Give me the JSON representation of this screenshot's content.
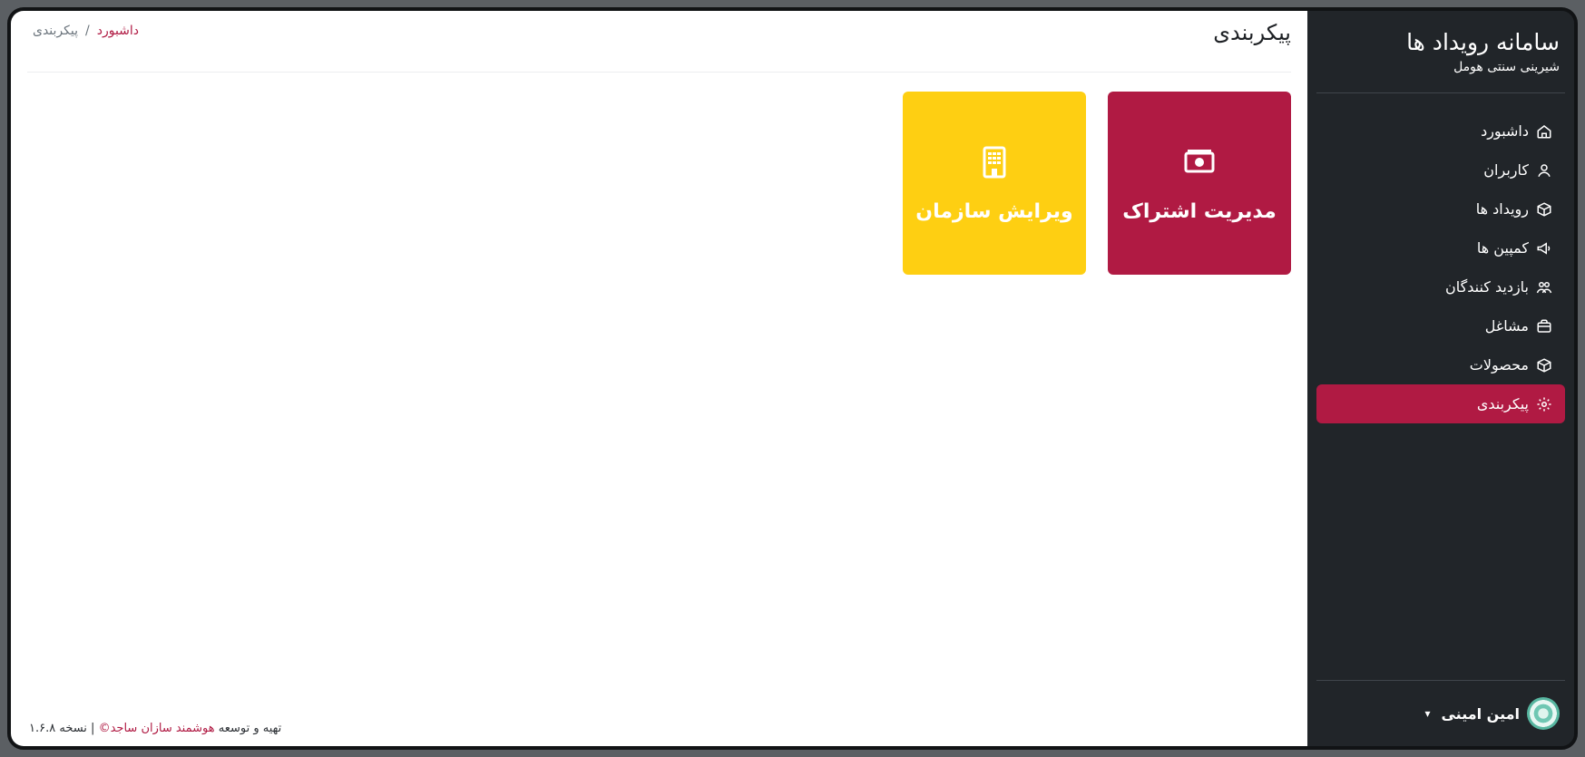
{
  "app": {
    "title": "سامانه رویداد ها",
    "org": "شیرینی سنتی هومل"
  },
  "sidebar": {
    "items": [
      {
        "label": "داشبورد",
        "icon": "home-icon"
      },
      {
        "label": "کاربران",
        "icon": "user-icon"
      },
      {
        "label": "رویداد ها",
        "icon": "box-icon"
      },
      {
        "label": "کمپین ها",
        "icon": "megaphone-icon"
      },
      {
        "label": "بازدید کنندگان",
        "icon": "users-icon"
      },
      {
        "label": "مشاغل",
        "icon": "briefcase-icon"
      },
      {
        "label": "محصولات",
        "icon": "package-icon"
      },
      {
        "label": "پیکربندی",
        "icon": "gear-icon",
        "active": true
      }
    ],
    "user": {
      "name": "امین امینی",
      "menu_caret": "▾"
    }
  },
  "header": {
    "title": "پیکربندی",
    "breadcrumb": {
      "home": "داشبورد",
      "separator": "/",
      "current": "پیکربندی"
    }
  },
  "cards": [
    {
      "label": "مدیریت اشتراک",
      "icon": "money-icon",
      "color": "#b01a43"
    },
    {
      "label": "ویرایش سازمان",
      "icon": "building-icon",
      "color": "#fecf12"
    }
  ],
  "footer": {
    "prefix": "تهیه و توسعه",
    "company": "هوشمند سازان ساجد©",
    "version": "| نسخه ۱.۶.۸"
  },
  "colors": {
    "accent": "#b01a43",
    "warning": "#fecf12",
    "sidebar": "#212529"
  }
}
